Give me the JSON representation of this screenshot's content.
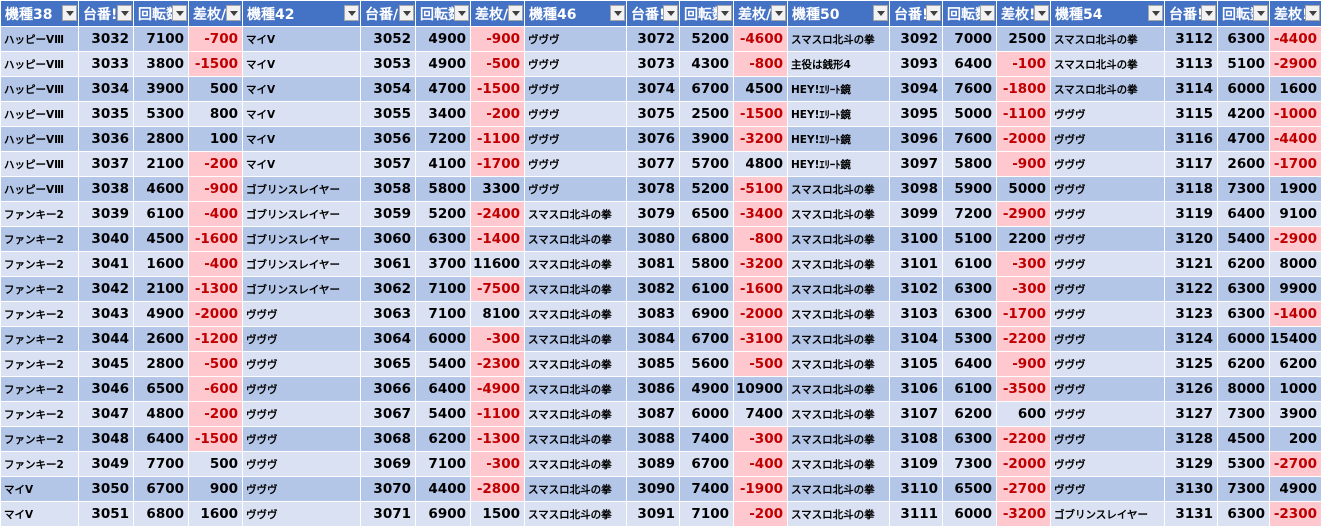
{
  "headers": [
    "機種38",
    "台番!",
    "回転数",
    "差枚∕",
    "機種42",
    "台番∕",
    "回転数",
    "差枚∕",
    "機種46",
    "台番!",
    "回転数",
    "差枚∕",
    "機種50",
    "台番!",
    "回転数",
    "差枚!",
    "機種54",
    "台番!",
    "回転数",
    "差枚!"
  ],
  "rows": [
    [
      "ハッピーVⅢ",
      "3032",
      "7100",
      "-700",
      "マイV",
      "3052",
      "4900",
      "-900",
      "ヴヴヴ",
      "3072",
      "5200",
      "-4600",
      "スマスロ北斗の拳",
      "3092",
      "7000",
      "2500",
      "スマスロ北斗の拳",
      "3112",
      "6300",
      "-4400"
    ],
    [
      "ハッピーVⅢ",
      "3033",
      "3800",
      "-1500",
      "マイV",
      "3053",
      "4900",
      "-500",
      "ヴヴヴ",
      "3073",
      "4300",
      "-800",
      "主役は銭形4",
      "3093",
      "6400",
      "-100",
      "スマスロ北斗の拳",
      "3113",
      "5100",
      "-2900"
    ],
    [
      "ハッピーVⅢ",
      "3034",
      "3900",
      "500",
      "マイV",
      "3054",
      "4700",
      "-1500",
      "ヴヴヴ",
      "3074",
      "6700",
      "4500",
      "HEY!ｴﾘｰﾄ鏡",
      "3094",
      "7600",
      "-1800",
      "スマスロ北斗の拳",
      "3114",
      "6000",
      "1600"
    ],
    [
      "ハッピーVⅢ",
      "3035",
      "5300",
      "800",
      "マイV",
      "3055",
      "3400",
      "-200",
      "ヴヴヴ",
      "3075",
      "2500",
      "-1500",
      "HEY!ｴﾘｰﾄ鏡",
      "3095",
      "5000",
      "-1100",
      "ヴヴヴ",
      "3115",
      "4200",
      "-1000"
    ],
    [
      "ハッピーVⅢ",
      "3036",
      "2800",
      "100",
      "マイV",
      "3056",
      "7200",
      "-1100",
      "ヴヴヴ",
      "3076",
      "3900",
      "-3200",
      "HEY!ｴﾘｰﾄ鏡",
      "3096",
      "7600",
      "-2000",
      "ヴヴヴ",
      "3116",
      "4700",
      "-4400"
    ],
    [
      "ハッピーVⅢ",
      "3037",
      "2100",
      "-200",
      "マイV",
      "3057",
      "4100",
      "-1700",
      "ヴヴヴ",
      "3077",
      "5700",
      "4800",
      "HEY!ｴﾘｰﾄ鏡",
      "3097",
      "5800",
      "-900",
      "ヴヴヴ",
      "3117",
      "2600",
      "-1700"
    ],
    [
      "ハッピーVⅢ",
      "3038",
      "4600",
      "-900",
      "ゴブリンスレイヤー",
      "3058",
      "5800",
      "3300",
      "ヴヴヴ",
      "3078",
      "5200",
      "-5100",
      "スマスロ北斗の拳",
      "3098",
      "5900",
      "5000",
      "ヴヴヴ",
      "3118",
      "7300",
      "1900"
    ],
    [
      "ファンキー2",
      "3039",
      "6100",
      "-400",
      "ゴブリンスレイヤー",
      "3059",
      "5200",
      "-2400",
      "スマスロ北斗の拳",
      "3079",
      "6500",
      "-3400",
      "スマスロ北斗の拳",
      "3099",
      "7200",
      "-2900",
      "ヴヴヴ",
      "3119",
      "6400",
      "9100"
    ],
    [
      "ファンキー2",
      "3040",
      "4500",
      "-1600",
      "ゴブリンスレイヤー",
      "3060",
      "6300",
      "-1400",
      "スマスロ北斗の拳",
      "3080",
      "6800",
      "-800",
      "スマスロ北斗の拳",
      "3100",
      "5100",
      "2200",
      "ヴヴヴ",
      "3120",
      "5400",
      "-2900"
    ],
    [
      "ファンキー2",
      "3041",
      "1600",
      "-400",
      "ゴブリンスレイヤー",
      "3061",
      "3700",
      "11600",
      "スマスロ北斗の拳",
      "3081",
      "5800",
      "-3200",
      "スマスロ北斗の拳",
      "3101",
      "6100",
      "-300",
      "ヴヴヴ",
      "3121",
      "6200",
      "8000"
    ],
    [
      "ファンキー2",
      "3042",
      "2100",
      "-1300",
      "ゴブリンスレイヤー",
      "3062",
      "7100",
      "-7500",
      "スマスロ北斗の拳",
      "3082",
      "6100",
      "-1600",
      "スマスロ北斗の拳",
      "3102",
      "6300",
      "-300",
      "ヴヴヴ",
      "3122",
      "6300",
      "9900"
    ],
    [
      "ファンキー2",
      "3043",
      "4900",
      "-2000",
      "ヴヴヴ",
      "3063",
      "7100",
      "8100",
      "スマスロ北斗の拳",
      "3083",
      "6900",
      "-2000",
      "スマスロ北斗の拳",
      "3103",
      "6300",
      "-1700",
      "ヴヴヴ",
      "3123",
      "6300",
      "-1400"
    ],
    [
      "ファンキー2",
      "3044",
      "2600",
      "-1200",
      "ヴヴヴ",
      "3064",
      "6000",
      "-300",
      "スマスロ北斗の拳",
      "3084",
      "6700",
      "-3100",
      "スマスロ北斗の拳",
      "3104",
      "5300",
      "-2200",
      "ヴヴヴ",
      "3124",
      "6000",
      "15400"
    ],
    [
      "ファンキー2",
      "3045",
      "2800",
      "-500",
      "ヴヴヴ",
      "3065",
      "5400",
      "-2300",
      "スマスロ北斗の拳",
      "3085",
      "5600",
      "-500",
      "スマスロ北斗の拳",
      "3105",
      "6400",
      "-900",
      "ヴヴヴ",
      "3125",
      "6200",
      "6200"
    ],
    [
      "ファンキー2",
      "3046",
      "6500",
      "-600",
      "ヴヴヴ",
      "3066",
      "6400",
      "-4900",
      "スマスロ北斗の拳",
      "3086",
      "4900",
      "10900",
      "スマスロ北斗の拳",
      "3106",
      "6100",
      "-3500",
      "ヴヴヴ",
      "3126",
      "8000",
      "1000"
    ],
    [
      "ファンキー2",
      "3047",
      "4800",
      "-200",
      "ヴヴヴ",
      "3067",
      "5400",
      "-1100",
      "スマスロ北斗の拳",
      "3087",
      "6000",
      "7400",
      "スマスロ北斗の拳",
      "3107",
      "6200",
      "600",
      "ヴヴヴ",
      "3127",
      "7300",
      "3900"
    ],
    [
      "ファンキー2",
      "3048",
      "6400",
      "-1500",
      "ヴヴヴ",
      "3068",
      "6200",
      "-1300",
      "スマスロ北斗の拳",
      "3088",
      "7400",
      "-300",
      "スマスロ北斗の拳",
      "3108",
      "6300",
      "-2200",
      "ヴヴヴ",
      "3128",
      "4500",
      "200"
    ],
    [
      "ファンキー2",
      "3049",
      "7700",
      "500",
      "ヴヴヴ",
      "3069",
      "7100",
      "-300",
      "スマスロ北斗の拳",
      "3089",
      "6700",
      "-400",
      "スマスロ北斗の拳",
      "3109",
      "7300",
      "-2000",
      "ヴヴヴ",
      "3129",
      "5300",
      "-2700"
    ],
    [
      "マイV",
      "3050",
      "6700",
      "900",
      "ヴヴヴ",
      "3070",
      "4400",
      "-2800",
      "スマスロ北斗の拳",
      "3090",
      "7400",
      "-1900",
      "スマスロ北斗の拳",
      "3110",
      "6500",
      "-2700",
      "ヴヴヴ",
      "3130",
      "7300",
      "4900"
    ],
    [
      "マイV",
      "3051",
      "6800",
      "1600",
      "ヴヴヴ",
      "3071",
      "6900",
      "1500",
      "スマスロ北斗の拳",
      "3091",
      "7100",
      "-200",
      "スマスロ北斗の拳",
      "3111",
      "6000",
      "-3200",
      "ゴブリンスレイヤー",
      "3131",
      "6300",
      "-2300"
    ]
  ],
  "colors": {
    "header_bg": "#4472c4",
    "row_band_dark": "#b4c6e7",
    "row_band_light": "#d9e1f2",
    "negative_fill": "#ffc7ce",
    "negative_text": "#c00000"
  }
}
